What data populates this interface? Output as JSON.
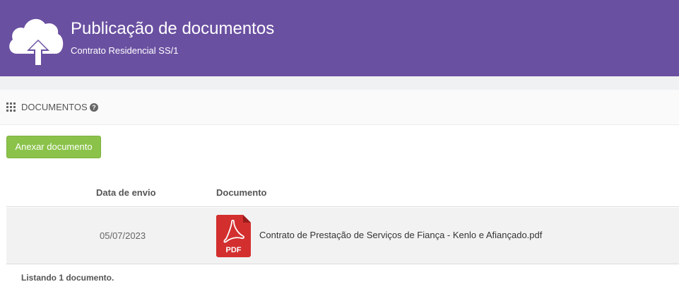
{
  "header": {
    "title": "Publicação de documentos",
    "subtitle": "Contrato Residencial SS/1",
    "background_color": "#6a50a1",
    "icon": "cloud-upload-icon"
  },
  "section": {
    "title": "DOCUMENTOS",
    "icon": "grid-icon",
    "help_icon": "help-icon"
  },
  "actions": {
    "attach_label": "Anexar documento",
    "attach_color": "#8bc34a"
  },
  "table": {
    "columns": [
      "Data de envio",
      "Documento"
    ],
    "rows": [
      {
        "date": "05/07/2023",
        "file_icon": "pdf-icon",
        "file_icon_label": "PDF",
        "document": "Contrato de Prestação de Serviços de Fiança - Kenlo e Afiançado.pdf"
      }
    ]
  },
  "footer": {
    "count_text": "Listando 1 documento."
  }
}
